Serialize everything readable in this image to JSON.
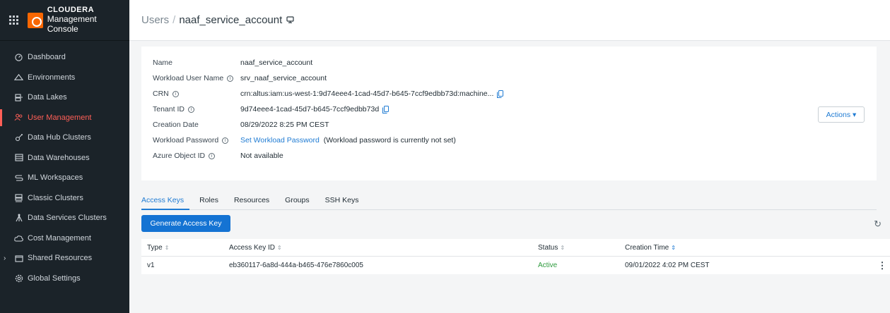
{
  "brand": {
    "top": "CLOUDERA",
    "bottom": "Management Console"
  },
  "sidebar": {
    "items": [
      {
        "label": "Dashboard",
        "icon": "dashboard-gauge-icon"
      },
      {
        "label": "Environments",
        "icon": "cloud-icon"
      },
      {
        "label": "Data Lakes",
        "icon": "data-lakes-icon"
      },
      {
        "label": "User Management",
        "icon": "users-icon",
        "active": true
      },
      {
        "label": "Data Hub Clusters",
        "icon": "data-hub-icon"
      },
      {
        "label": "Data Warehouses",
        "icon": "warehouse-icon"
      },
      {
        "label": "ML Workspaces",
        "icon": "ml-icon"
      },
      {
        "label": "Classic Clusters",
        "icon": "classic-clusters-icon"
      },
      {
        "label": "Data Services Clusters",
        "icon": "data-services-icon"
      },
      {
        "label": "Cost Management",
        "icon": "cost-cloud-icon"
      },
      {
        "label": "Shared Resources",
        "icon": "shared-resources-icon"
      },
      {
        "label": "Global Settings",
        "icon": "gear-icon"
      }
    ]
  },
  "header": {
    "crumb_root": "Users",
    "separator": "/",
    "title": "naaf_service_account"
  },
  "details": {
    "name_label": "Name",
    "name_value": "naaf_service_account",
    "wuser_label": "Workload User Name",
    "wuser_value": "srv_naaf_service_account",
    "crn_label": "CRN",
    "crn_value": "crn:altus:iam:us-west-1:9d74eee4-1cad-45d7-b645-7ccf9edbb73d:machine...",
    "tenant_label": "Tenant ID",
    "tenant_value": "9d74eee4-1cad-45d7-b645-7ccf9edbb73d",
    "created_label": "Creation Date",
    "created_value": "08/29/2022 8:25 PM CEST",
    "wpass_label": "Workload Password",
    "wpass_link": "Set Workload Password",
    "wpass_note": "(Workload password is currently not set)",
    "azure_label": "Azure Object ID",
    "azure_value": "Not available",
    "actions_label": "Actions"
  },
  "tabs": [
    "Access Keys",
    "Roles",
    "Resources",
    "Groups",
    "SSH Keys"
  ],
  "generate_label": "Generate Access Key",
  "table": {
    "headers": [
      "Type",
      "Access Key ID",
      "Status",
      "Creation Time"
    ],
    "rows": [
      {
        "type": "v1",
        "key_id": "eb360117-6a8d-444a-b465-476e7860c005",
        "status": "Active",
        "created": "09/01/2022 4:02 PM CEST"
      }
    ]
  },
  "colors": {
    "accent": "#1473d3",
    "active_nav": "#ff5f57",
    "status_active": "#2e9b3e",
    "sidebar_bg": "#1b2329"
  }
}
